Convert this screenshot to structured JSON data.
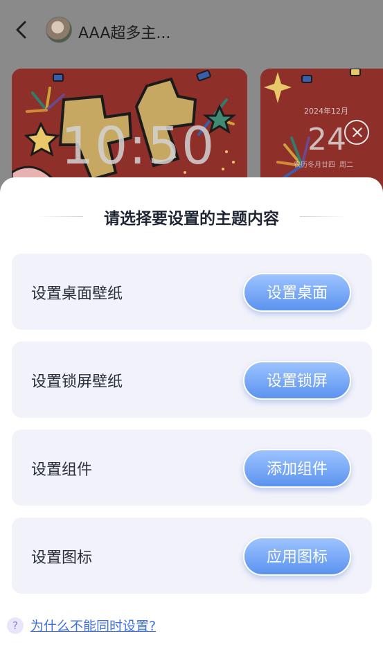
{
  "header": {
    "author_name": "AAA超多主..."
  },
  "previews": {
    "clock_time": "10:50",
    "calendar_month": "2024年12月",
    "calendar_day": "24",
    "calendar_lunar": "农历冬月廿四",
    "calendar_weekday": "周二"
  },
  "sheet": {
    "title": "请选择要设置的主题内容",
    "options": [
      {
        "label": "设置桌面壁纸",
        "button": "设置桌面"
      },
      {
        "label": "设置锁屏壁纸",
        "button": "设置锁屏"
      },
      {
        "label": "设置组件",
        "button": "添加组件"
      },
      {
        "label": "设置图标",
        "button": "应用图标"
      }
    ],
    "help_icon_glyph": "?",
    "help_link": "为什么不能同时设置?"
  },
  "colors": {
    "accent_button": "#5b93ef",
    "option_bg": "#f2f2fb",
    "link": "#3f6fe0"
  }
}
